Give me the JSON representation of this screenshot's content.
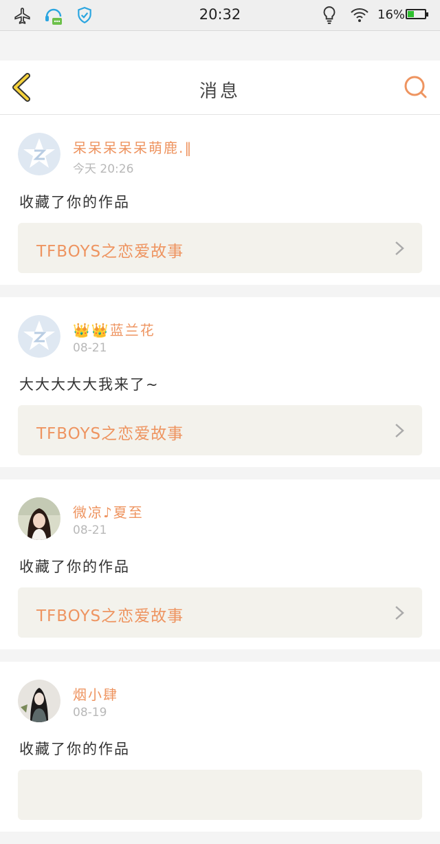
{
  "status_bar": {
    "time": "20:32",
    "battery_percent": "16%",
    "icons": [
      "airplane-icon",
      "chat-notification-icon",
      "shield-icon",
      "lightbulb-icon",
      "wifi-icon",
      "battery-icon"
    ]
  },
  "header": {
    "title": "消息",
    "back_icon": "chevron-left-icon",
    "search_icon": "search-icon"
  },
  "colors": {
    "accent_orange": "#ee9460",
    "back_yellow": "#f6d23c",
    "work_bg": "#f3f2ec"
  },
  "messages": [
    {
      "name": "呆呆呆呆呆萌鹿.‖",
      "time": "今天 20:26",
      "text": "收藏了你的作品",
      "work_title": "TFBOYS之恋爱故事",
      "avatar": "qq-default-avatar"
    },
    {
      "name": "👑👑蓝兰花",
      "time": "08-21",
      "text": "大大大大大我来了~",
      "work_title": "TFBOYS之恋爱故事",
      "avatar": "qq-default-avatar"
    },
    {
      "name": "微凉♪夏至",
      "time": "08-21",
      "text": "收藏了你的作品",
      "work_title": "TFBOYS之恋爱故事",
      "avatar": "user-photo-avatar"
    },
    {
      "name": "烟小肆",
      "time": "08-19",
      "text": "收藏了你的作品",
      "work_title": "",
      "avatar": "user-illustration-avatar"
    }
  ]
}
